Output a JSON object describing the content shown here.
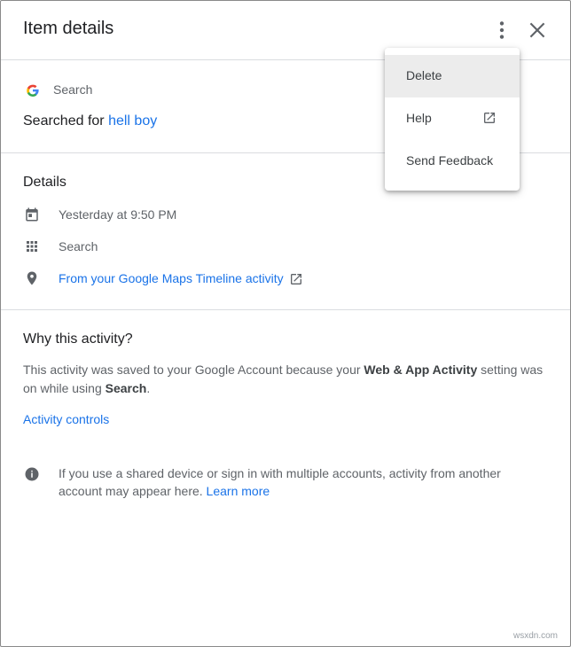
{
  "header": {
    "title": "Item details",
    "more_icon": "more-vert-icon",
    "close_icon": "close-icon"
  },
  "item": {
    "product": "Search",
    "searched_prefix": "Searched for",
    "query": "hell boy",
    "product_icon": "google-g-icon"
  },
  "details": {
    "heading": "Details",
    "rows": [
      {
        "icon": "calendar-icon",
        "text": "Yesterday at 9:50 PM"
      },
      {
        "icon": "apps-grid-icon",
        "text": "Search"
      },
      {
        "icon": "location-pin-icon",
        "text": "From your Google Maps Timeline activity"
      }
    ]
  },
  "why": {
    "heading": "Why this activity?",
    "text_1": "This activity was saved to your Google Account because your",
    "bold_1": "Web & App Activity",
    "text_2": "setting was on while using",
    "bold_2": "Search",
    "text_3": ".",
    "controls_link": "Activity controls",
    "info_text": "If you use a shared device or sign in with multiple accounts, activity from another account may appear here.",
    "learn_more": "Learn more"
  },
  "menu": {
    "items": [
      {
        "label": "Delete",
        "active": true
      },
      {
        "label": "Help",
        "icon": "open-in-new-icon"
      },
      {
        "label": "Send Feedback"
      }
    ]
  },
  "watermark": "wsxdn.com",
  "colors": {
    "link": "#1a73e8",
    "divider": "#dadce0",
    "menu_active": "#ececec"
  }
}
